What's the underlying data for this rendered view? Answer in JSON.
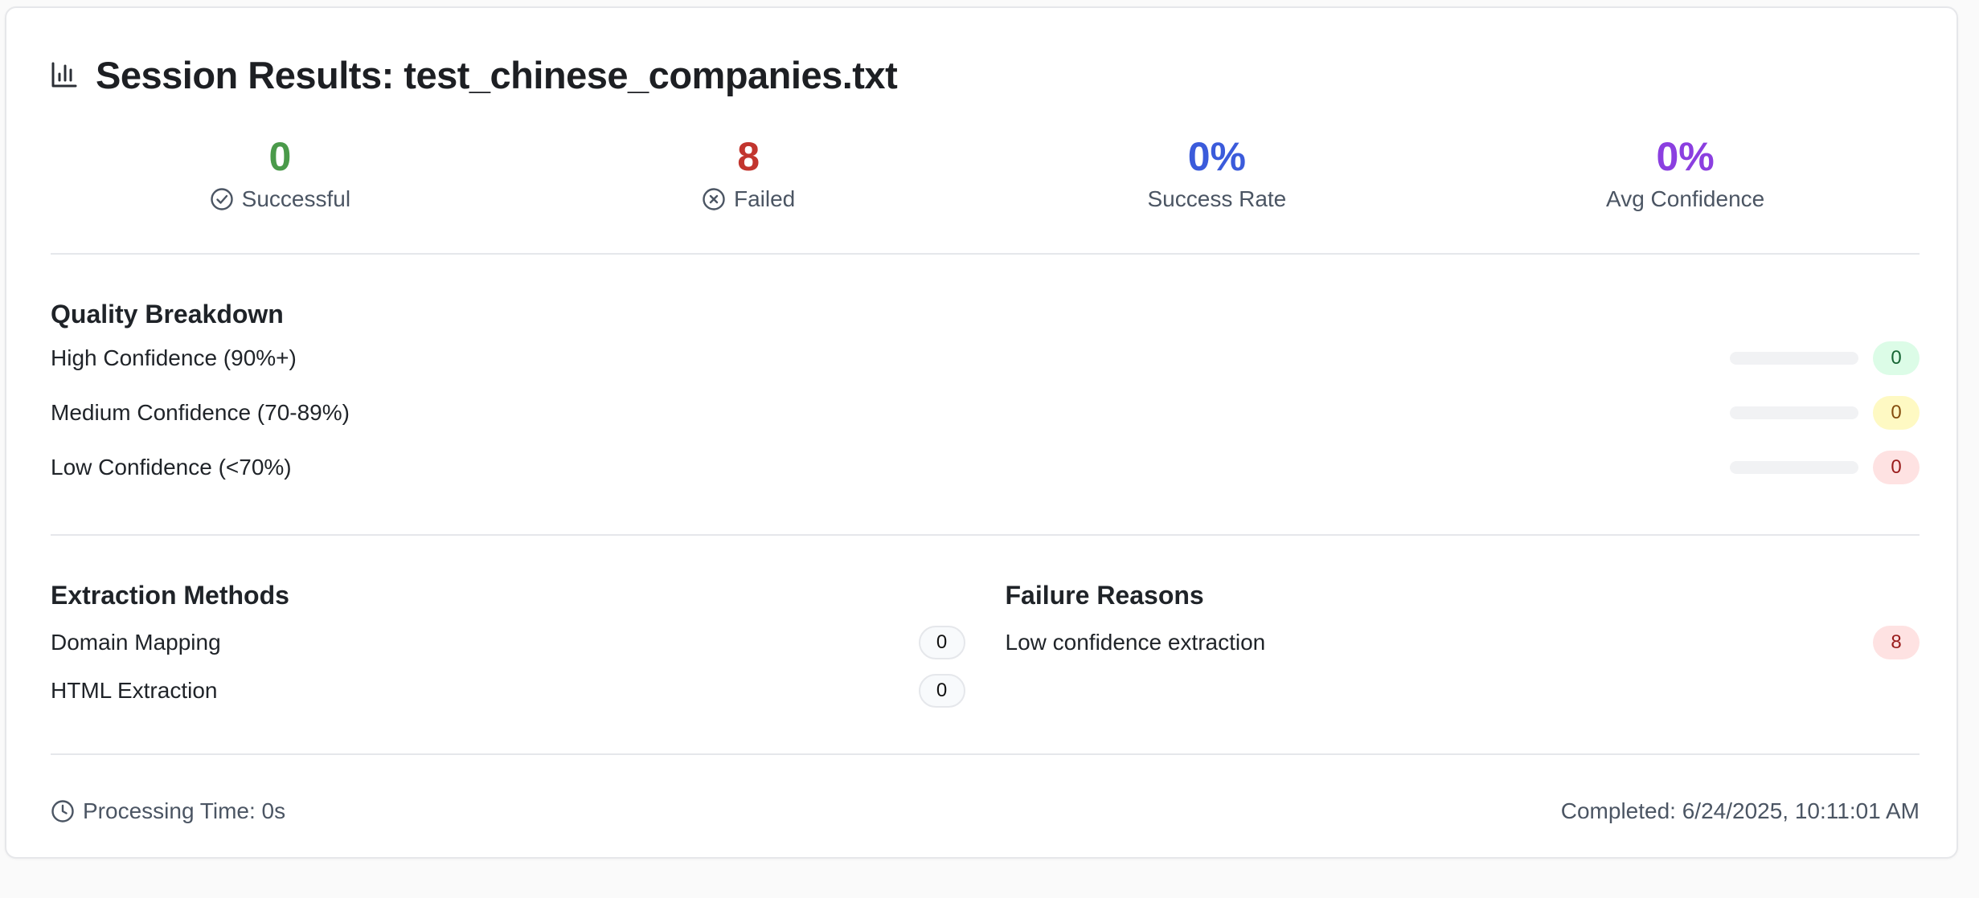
{
  "header": {
    "icon": "bar-chart-icon",
    "title": "Session Results: test_chinese_companies.txt"
  },
  "stats": [
    {
      "value": "0",
      "label": "Successful",
      "icon": "check-circle-icon",
      "color": "#4a9a4a"
    },
    {
      "value": "8",
      "label": "Failed",
      "icon": "x-circle-icon",
      "color": "#c2352e"
    },
    {
      "value": "0%",
      "label": "Success Rate",
      "icon": "",
      "color": "#3b5bdb"
    },
    {
      "value": "0%",
      "label": "Avg Confidence",
      "icon": "",
      "color": "#8b3fe0"
    }
  ],
  "quality": {
    "title": "Quality Breakdown",
    "rows": [
      {
        "label": "High Confidence (90%+)",
        "count": "0",
        "fraction": 0,
        "badge_color": "#dcfce7"
      },
      {
        "label": "Medium Confidence (70-89%)",
        "count": "0",
        "fraction": 0,
        "badge_color": "#fef9c3"
      },
      {
        "label": "Low Confidence (<70%)",
        "count": "0",
        "fraction": 0,
        "badge_color": "#fee2e2"
      }
    ]
  },
  "extraction": {
    "title": "Extraction Methods",
    "rows": [
      {
        "label": "Domain Mapping",
        "count": "0"
      },
      {
        "label": "HTML Extraction",
        "count": "0"
      }
    ]
  },
  "failures": {
    "title": "Failure Reasons",
    "rows": [
      {
        "label": "Low confidence extraction",
        "count": "8"
      }
    ]
  },
  "footer": {
    "processing_time": "Processing Time: 0s",
    "completed": "Completed: 6/24/2025, 10:11:01 AM"
  }
}
